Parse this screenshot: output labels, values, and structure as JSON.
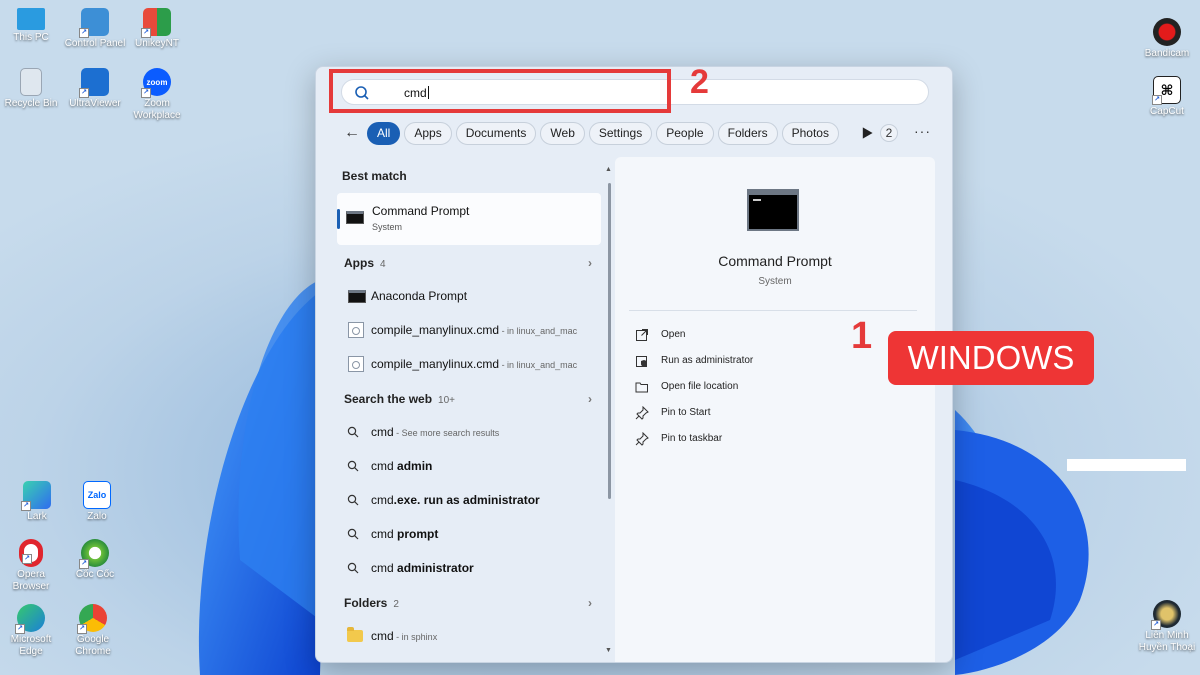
{
  "desktop": {
    "icons_left": [
      {
        "label": "This PC",
        "icon": "monitor-icon"
      },
      {
        "label": "Control Panel",
        "icon": "control-panel-icon"
      },
      {
        "label": "UnikeyNT",
        "icon": "unikey-icon"
      },
      {
        "label": "Recycle Bin",
        "icon": "recycle-bin-icon"
      },
      {
        "label": "UltraViewer",
        "icon": "ultraviewer-icon"
      },
      {
        "label": "Zoom Workplace",
        "icon": "zoom-icon",
        "glyph": "zoom"
      },
      {
        "label": "Lark",
        "icon": "lark-icon"
      },
      {
        "label": "Zalo",
        "icon": "zalo-icon",
        "glyph": "Zalo"
      },
      {
        "label": "Opera Browser",
        "icon": "opera-icon"
      },
      {
        "label": "Cốc Cốc",
        "icon": "coccoc-icon"
      },
      {
        "label": "Microsoft Edge",
        "icon": "edge-icon"
      },
      {
        "label": "Google Chrome",
        "icon": "chrome-icon"
      }
    ],
    "icons_right": [
      {
        "label": "Bandicam",
        "icon": "bandicam-icon"
      },
      {
        "label": "CapCut",
        "icon": "capcut-icon"
      },
      {
        "label": "Liên Minh Huyền Thoại",
        "icon": "lol-icon"
      }
    ]
  },
  "search": {
    "query": "cmd",
    "filters": [
      "All",
      "Apps",
      "Documents",
      "Web",
      "Settings",
      "People",
      "Folders",
      "Photos"
    ],
    "active_filter": "All",
    "extra_count": "2",
    "more_glyph": "···",
    "back_glyph": "←"
  },
  "results": {
    "best_match_title": "Best match",
    "best_match": {
      "name": "Command Prompt",
      "type": "System"
    },
    "apps_title": "Apps",
    "apps_count": "4",
    "apps": [
      {
        "name": "Anaconda Prompt",
        "sub": "",
        "icon": "cmd-icon"
      },
      {
        "name": "compile_manylinux.cmd",
        "sub": " - in linux_and_mac",
        "icon": "script-icon"
      },
      {
        "name": "compile_manylinux.cmd",
        "sub": " - in linux_and_mac",
        "icon": "script-icon"
      }
    ],
    "web_title": "Search the web",
    "web_count": "10+",
    "web": [
      {
        "plain": "cmd",
        "bold": "",
        "sub": " - See more search results"
      },
      {
        "plain": "cmd ",
        "bold": "admin",
        "sub": ""
      },
      {
        "plain": "cmd",
        "bold": ".exe. run as administrator",
        "sub": ""
      },
      {
        "plain": "cmd ",
        "bold": "prompt",
        "sub": ""
      },
      {
        "plain": "cmd ",
        "bold": "administrator",
        "sub": ""
      }
    ],
    "folders_title": "Folders",
    "folders_count": "2",
    "folders": [
      {
        "name": "cmd",
        "sub": " - in sphinx"
      }
    ]
  },
  "preview": {
    "title": "Command Prompt",
    "subtitle": "System",
    "actions": [
      {
        "label": "Open",
        "icon": "open-icon"
      },
      {
        "label": "Run as administrator",
        "icon": "admin-shield-icon"
      },
      {
        "label": "Open file location",
        "icon": "folder-open-icon"
      },
      {
        "label": "Pin to Start",
        "icon": "pin-icon"
      },
      {
        "label": "Pin to taskbar",
        "icon": "pin-icon"
      }
    ]
  },
  "annotations": {
    "step_search": "2",
    "step_windows": "1",
    "windows_label": "WINDOWS",
    "color": "#e53a3a"
  }
}
